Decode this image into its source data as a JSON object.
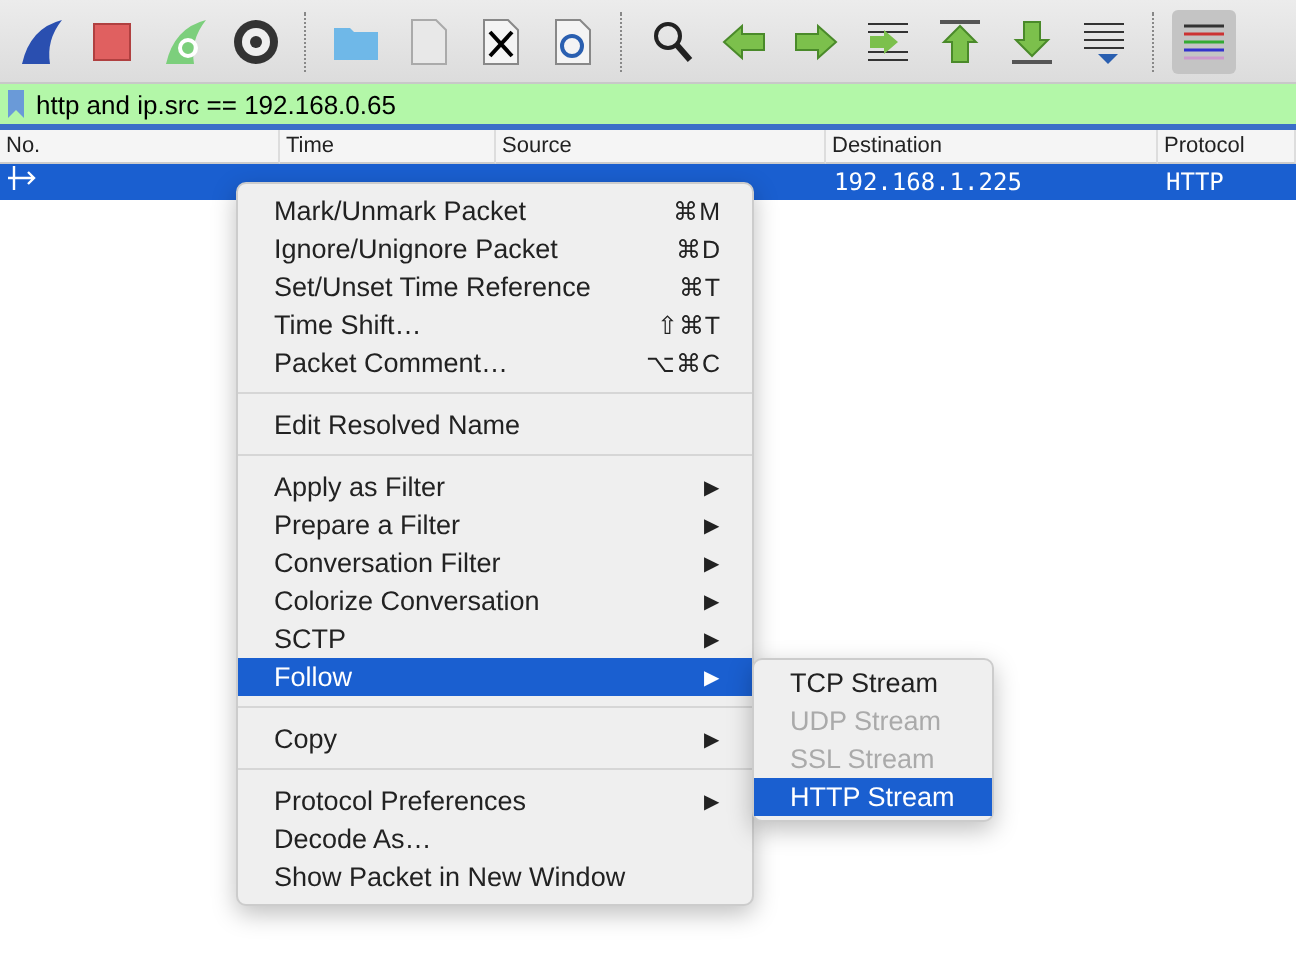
{
  "toolbar": [
    {
      "selected": false
    },
    {
      "selected": false
    },
    {
      "selected": false
    },
    {
      "selected": false
    },
    {
      "selected": false
    },
    {
      "selected": false
    },
    {
      "selected": false
    },
    {
      "selected": false
    },
    {
      "selected": false
    },
    {
      "selected": false
    },
    {
      "selected": false
    },
    {
      "selected": false
    },
    {
      "selected": false
    },
    {
      "selected": false
    },
    {
      "selected": false
    },
    {
      "selected": true
    }
  ],
  "filter": {
    "value": "http and ip.src == 192.168.0.65"
  },
  "table": {
    "columns": [
      "No.",
      "Time",
      "Source",
      "Destination",
      "Protocol"
    ],
    "rows": [
      {
        "selected": true,
        "destination": "192.168.1.225",
        "protocol": "HTTP"
      }
    ]
  },
  "context_menu": {
    "items": [
      {
        "kind": "item",
        "label": "Mark/Unmark Packet",
        "shortcut": "⌘M",
        "selected": false
      },
      {
        "kind": "item",
        "label": "Ignore/Unignore Packet",
        "shortcut": "⌘D",
        "selected": false
      },
      {
        "kind": "item",
        "label": "Set/Unset Time Reference",
        "shortcut": "⌘T",
        "selected": false
      },
      {
        "kind": "item",
        "label": "Time Shift…",
        "shortcut": "⇧⌘T",
        "selected": false
      },
      {
        "kind": "item",
        "label": "Packet Comment…",
        "shortcut": "⌥⌘C",
        "selected": false
      },
      {
        "kind": "separator"
      },
      {
        "kind": "item",
        "label": "Edit Resolved Name",
        "selected": false
      },
      {
        "kind": "separator"
      },
      {
        "kind": "item",
        "label": "Apply as Filter",
        "arrow": "▶",
        "selected": false
      },
      {
        "kind": "item",
        "label": "Prepare a Filter",
        "arrow": "▶",
        "selected": false
      },
      {
        "kind": "item",
        "label": "Conversation Filter",
        "arrow": "▶",
        "selected": false
      },
      {
        "kind": "item",
        "label": "Colorize Conversation",
        "arrow": "▶",
        "selected": false
      },
      {
        "kind": "item",
        "label": "SCTP",
        "arrow": "▶",
        "selected": false
      },
      {
        "kind": "item",
        "label": "Follow",
        "arrow": "▶",
        "selected": true
      },
      {
        "kind": "separator"
      },
      {
        "kind": "item",
        "label": "Copy",
        "arrow": "▶",
        "selected": false
      },
      {
        "kind": "separator"
      },
      {
        "kind": "item",
        "label": "Protocol Preferences",
        "arrow": "▶",
        "selected": false
      },
      {
        "kind": "item",
        "label": "Decode As…",
        "selected": false
      },
      {
        "kind": "item",
        "label": "Show Packet in New Window",
        "selected": false
      }
    ]
  },
  "submenu": {
    "items": [
      {
        "label": "TCP Stream",
        "disabled": false,
        "selected": false
      },
      {
        "label": "UDP Stream",
        "disabled": true,
        "selected": false
      },
      {
        "label": "SSL Stream",
        "disabled": true,
        "selected": false
      },
      {
        "label": "HTTP Stream",
        "disabled": false,
        "selected": true
      }
    ]
  }
}
